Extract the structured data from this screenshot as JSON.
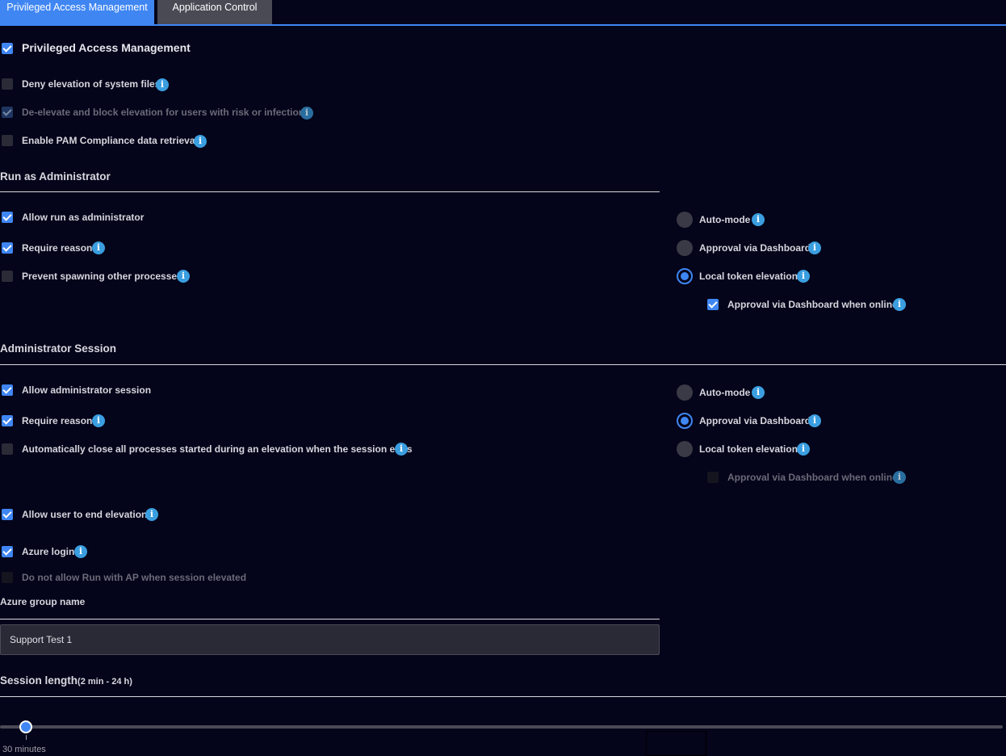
{
  "tabs": [
    {
      "label": "Privileged Access Management"
    },
    {
      "label": "Application Control"
    }
  ],
  "pam": {
    "main_label": "Privileged Access Management",
    "deny_label": "Deny elevation of system files",
    "deelevate_label": "De-elevate and block elevation for users with risk or infections",
    "compliance_label": "Enable PAM Compliance data retrieval"
  },
  "run_as_admin": {
    "heading": "Run as Administrator",
    "allow_label": "Allow run as administrator",
    "reason_label": "Require reason",
    "prevent_label": "Prevent spawning other processes",
    "mode_auto": "Auto-mode",
    "mode_dashboard": "Approval via Dashboard",
    "mode_local": "Local token elevation",
    "online_label": "Approval via Dashboard when online",
    "selected_mode": "Local token elevation"
  },
  "admin_session": {
    "heading": "Administrator Session",
    "allow_label": "Allow administrator session",
    "reason_label": "Require reason",
    "autoclose_label": "Automatically close all processes started during an elevation when the session ends",
    "mode_auto": "Auto-mode",
    "mode_dashboard": "Approval via Dashboard",
    "mode_local": "Local token elevation",
    "online_label": "Approval via Dashboard when online",
    "selected_mode": "Approval via Dashboard",
    "end_label": "Allow user to end elevation",
    "azure_label": "Azure login",
    "no_run_label": "Do not allow Run with AP when session elevated"
  },
  "azure_group": {
    "heading": "Azure group name",
    "value": "Support Test 1"
  },
  "session_length": {
    "heading": "Session length",
    "range": "(2 min - 24 h)",
    "value_label": "30 minutes",
    "value_minutes": 30
  },
  "colors": {
    "accent": "#3f86f3",
    "background": "#04041a",
    "info": "#3a9ee0"
  },
  "icons": {
    "info": "info-icon",
    "check": "checkmark-icon"
  }
}
